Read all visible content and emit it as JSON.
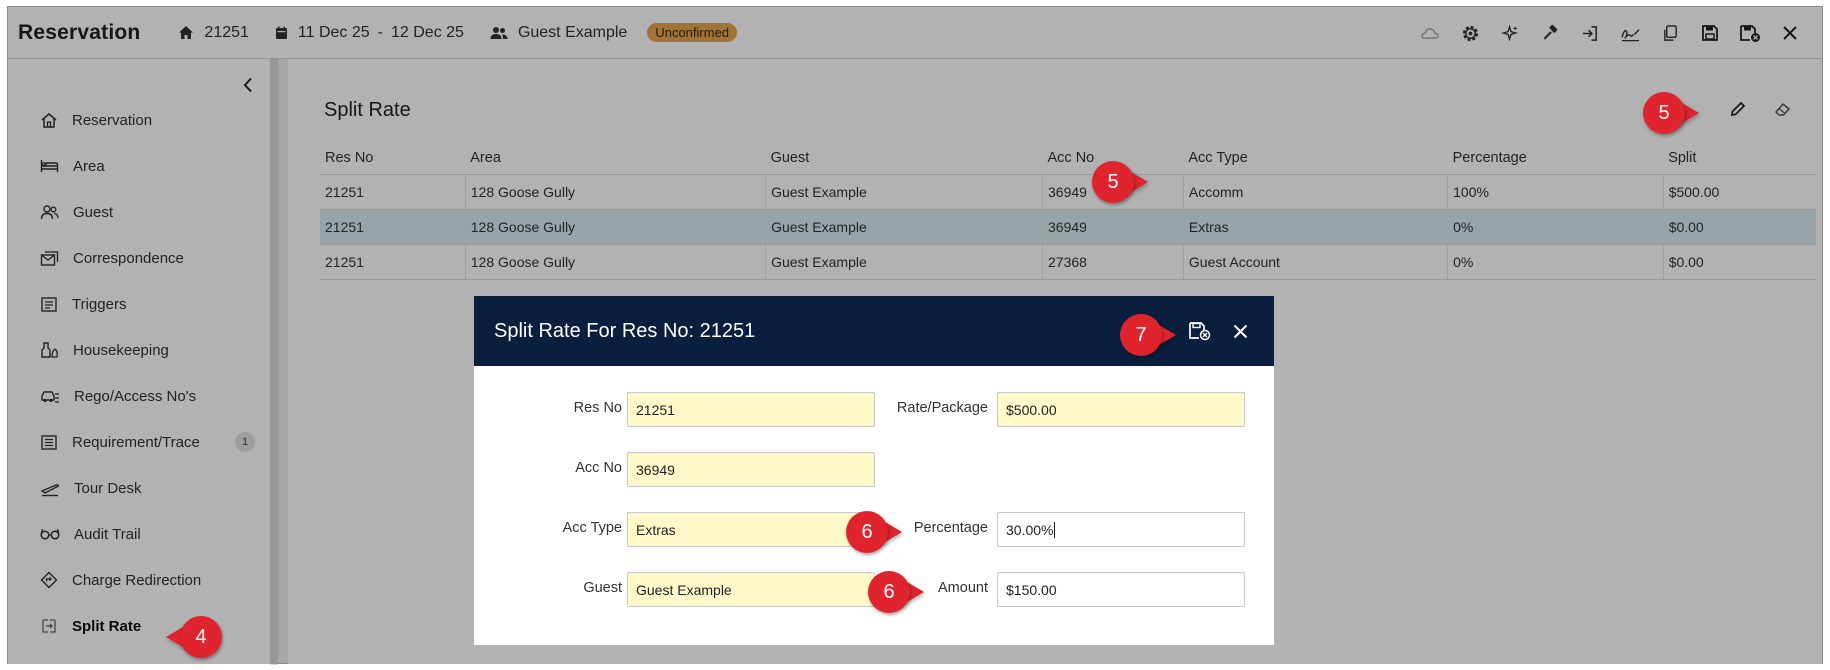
{
  "header": {
    "title": "Reservation",
    "res_no": "21251",
    "date_from": "11 Dec 25",
    "date_sep": "-",
    "date_to": "12 Dec 25",
    "guest": "Guest Example",
    "status": "Unconfirmed",
    "tools": [
      "cloud-icon",
      "gear-icon",
      "sparkle-icon",
      "hammer-icon",
      "check-in-icon",
      "signature-icon",
      "copy-icon",
      "save-icon",
      "save-close-icon",
      "close-icon"
    ]
  },
  "sidebar": {
    "items": [
      {
        "label": "Reservation",
        "icon": "home-icon"
      },
      {
        "label": "Area",
        "icon": "bed-icon"
      },
      {
        "label": "Guest",
        "icon": "users-icon"
      },
      {
        "label": "Correspondence",
        "icon": "mail-icon"
      },
      {
        "label": "Triggers",
        "icon": "triggers-icon"
      },
      {
        "label": "Housekeeping",
        "icon": "housekeeping-icon"
      },
      {
        "label": "Rego/Access No's",
        "icon": "car-icon"
      },
      {
        "label": "Requirement/Trace",
        "icon": "list-icon",
        "count": "1"
      },
      {
        "label": "Tour Desk",
        "icon": "plane-icon"
      },
      {
        "label": "Audit Trail",
        "icon": "glasses-icon"
      },
      {
        "label": "Charge Redirection",
        "icon": "redirect-icon"
      },
      {
        "label": "Split Rate",
        "icon": "split-icon"
      }
    ]
  },
  "main": {
    "title": "Split Rate",
    "columns": [
      "Res No",
      "Area",
      "Guest",
      "Acc No",
      "Acc Type",
      "Percentage",
      "Split"
    ],
    "rows": [
      [
        "21251",
        "128 Goose Gully",
        "Guest Example",
        "36949",
        "Accomm",
        "100%",
        "$500.00"
      ],
      [
        "21251",
        "128 Goose Gully",
        "Guest Example",
        "36949",
        "Extras",
        "0%",
        "$0.00"
      ],
      [
        "21251",
        "128 Goose Gully",
        "Guest Example",
        "27368",
        "Guest Account",
        "0%",
        "$0.00"
      ]
    ]
  },
  "modal": {
    "title": "Split Rate For Res No: 21251",
    "fields": {
      "res_no": {
        "label": "Res No",
        "value": "21251"
      },
      "rate_package": {
        "label": "Rate/Package",
        "value": "$500.00"
      },
      "acc_no": {
        "label": "Acc No",
        "value": "36949"
      },
      "acc_type": {
        "label": "Acc Type",
        "value": "Extras"
      },
      "percentage": {
        "label": "Percentage",
        "value": "30.00%"
      },
      "guest": {
        "label": "Guest",
        "value": "Guest Example"
      },
      "amount": {
        "label": "Amount",
        "value": "$150.00"
      }
    }
  },
  "markers": {
    "sidebar_split": "4",
    "edit_tool": "5",
    "acc_type_row": "5",
    "percentage": "6",
    "amount": "6",
    "save": "7"
  },
  "colors": {
    "accent_marker": "#e0242e",
    "modal_header": "#0a1f3d",
    "status_badge": "#e8a550",
    "selected_row": "#d8ecf2",
    "readonly_field": "#fff9c9"
  }
}
